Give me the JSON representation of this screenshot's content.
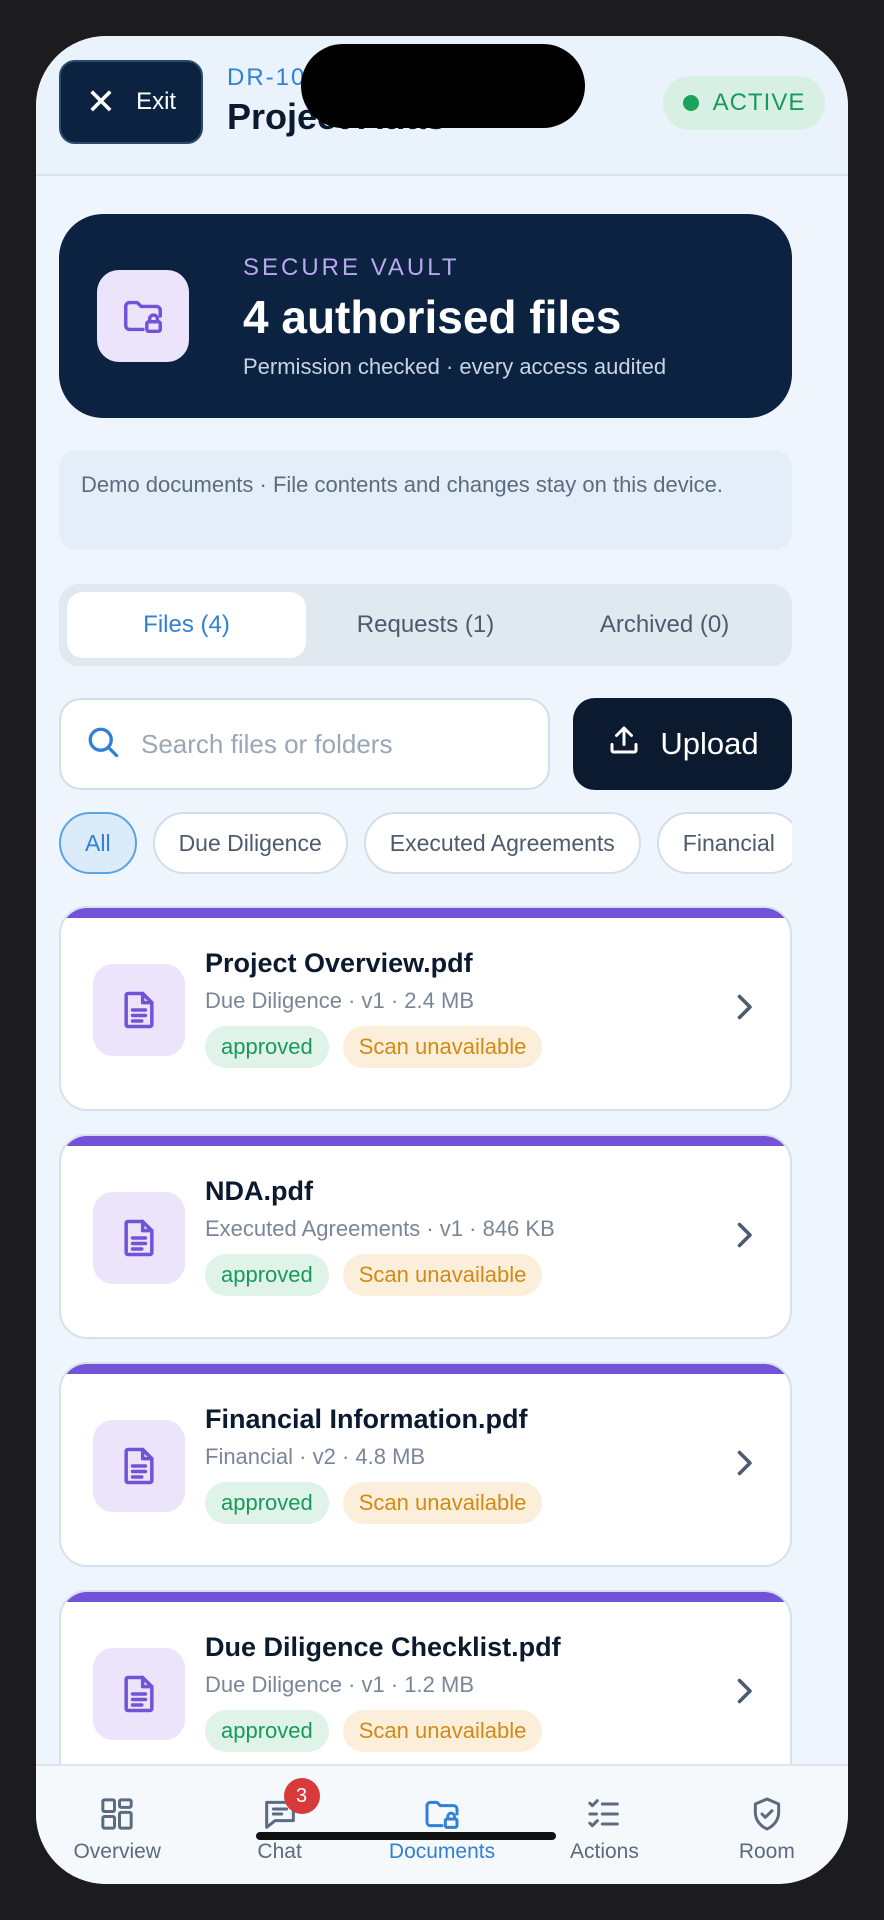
{
  "header": {
    "exit_label": "Exit",
    "room_id": "DR-10",
    "room_name": "Project Atlas",
    "status": "ACTIVE"
  },
  "vault": {
    "kicker": "SECURE VAULT",
    "title": "4 authorised files",
    "subtitle": "Permission checked · every access audited"
  },
  "notice": "Demo documents · File contents and changes stay on this device.",
  "tabs": [
    {
      "label": "Files (4)",
      "active": true
    },
    {
      "label": "Requests (1)",
      "active": false
    },
    {
      "label": "Archived (0)",
      "active": false
    }
  ],
  "search": {
    "placeholder": "Search files or folders",
    "value": ""
  },
  "upload_label": "Upload",
  "filters": [
    {
      "label": "All",
      "active": true
    },
    {
      "label": "Due Diligence",
      "active": false
    },
    {
      "label": "Executed Agreements",
      "active": false
    },
    {
      "label": "Financial",
      "active": false
    }
  ],
  "files": [
    {
      "name": "Project Overview.pdf",
      "meta": "Due Diligence · v1 · 2.4 MB",
      "status": "approved",
      "scan": "Scan unavailable"
    },
    {
      "name": "NDA.pdf",
      "meta": "Executed Agreements · v1 · 846 KB",
      "status": "approved",
      "scan": "Scan unavailable"
    },
    {
      "name": "Financial Information.pdf",
      "meta": "Financial · v2 · 4.8 MB",
      "status": "approved",
      "scan": "Scan unavailable"
    },
    {
      "name": "Due Diligence Checklist.pdf",
      "meta": "Due Diligence · v1 · 1.2 MB",
      "status": "approved",
      "scan": "Scan unavailable"
    }
  ],
  "nav": [
    {
      "label": "Overview",
      "icon": "grid-icon",
      "active": false,
      "badge": ""
    },
    {
      "label": "Chat",
      "icon": "chat-icon",
      "active": false,
      "badge": "3"
    },
    {
      "label": "Documents",
      "icon": "folder-lock-icon",
      "active": true,
      "badge": ""
    },
    {
      "label": "Actions",
      "icon": "checklist-icon",
      "active": false,
      "badge": ""
    },
    {
      "label": "Room",
      "icon": "shield-check-icon",
      "active": false,
      "badge": ""
    }
  ],
  "colors": {
    "navy": "#0b2340",
    "accent_blue": "#2f80d6",
    "accent_purple": "#7252d6",
    "success": "#179a5c",
    "warning": "#d48a12",
    "badge_red": "#d63a3a"
  }
}
